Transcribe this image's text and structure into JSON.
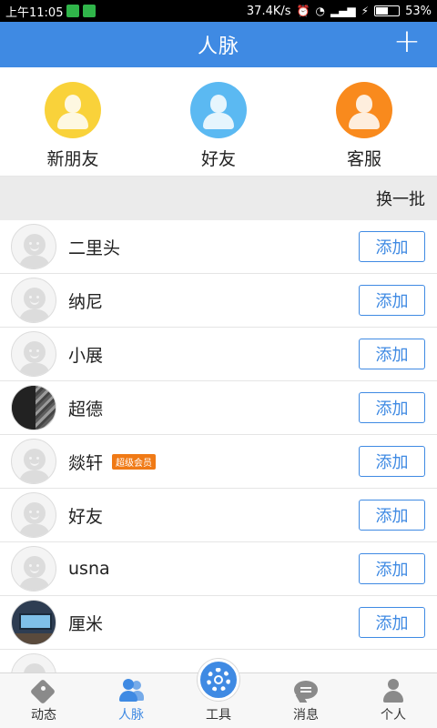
{
  "status_bar": {
    "time": "上午11:05",
    "network_speed": "37.4K/s",
    "battery": "53%",
    "battery_level": 0.53
  },
  "header": {
    "title": "人脉",
    "add_icon": "plus-icon"
  },
  "quick_entries": [
    {
      "label": "新朋友",
      "icon": "new-friend-icon",
      "color": "#f9d23a"
    },
    {
      "label": "好友",
      "icon": "friend-icon",
      "color": "#5bb9f2"
    },
    {
      "label": "客服",
      "icon": "customer-service-icon",
      "color": "#f98a1d"
    }
  ],
  "batch": {
    "refresh_label": "换一批"
  },
  "contacts": [
    {
      "name": "二里头",
      "avatar": "default",
      "vip": "",
      "action": "添加"
    },
    {
      "name": "纳尼",
      "avatar": "default",
      "vip": "",
      "action": "添加"
    },
    {
      "name": "小展",
      "avatar": "default",
      "vip": "",
      "action": "添加"
    },
    {
      "name": "超德",
      "avatar": "photo",
      "vip": "",
      "action": "添加"
    },
    {
      "name": "燚轩",
      "avatar": "default",
      "vip": "超级会员",
      "action": "添加"
    },
    {
      "name": "好友",
      "avatar": "default",
      "vip": "",
      "action": "添加"
    },
    {
      "name": "usna",
      "avatar": "default",
      "vip": "",
      "action": "添加"
    },
    {
      "name": "厘米",
      "avatar": "photo",
      "vip": "",
      "action": "添加"
    }
  ],
  "tab_bar": {
    "tabs": [
      {
        "label": "动态",
        "icon": "tag-icon",
        "active": false
      },
      {
        "label": "人脉",
        "icon": "people-icon",
        "active": true
      },
      {
        "label": "工具",
        "icon": "gear-icon",
        "active": false
      },
      {
        "label": "消息",
        "icon": "message-icon",
        "active": false
      },
      {
        "label": "个人",
        "icon": "person-icon",
        "active": false
      }
    ]
  },
  "colors": {
    "accent": "#3f8ae3",
    "vip_badge": "#f07a16"
  }
}
